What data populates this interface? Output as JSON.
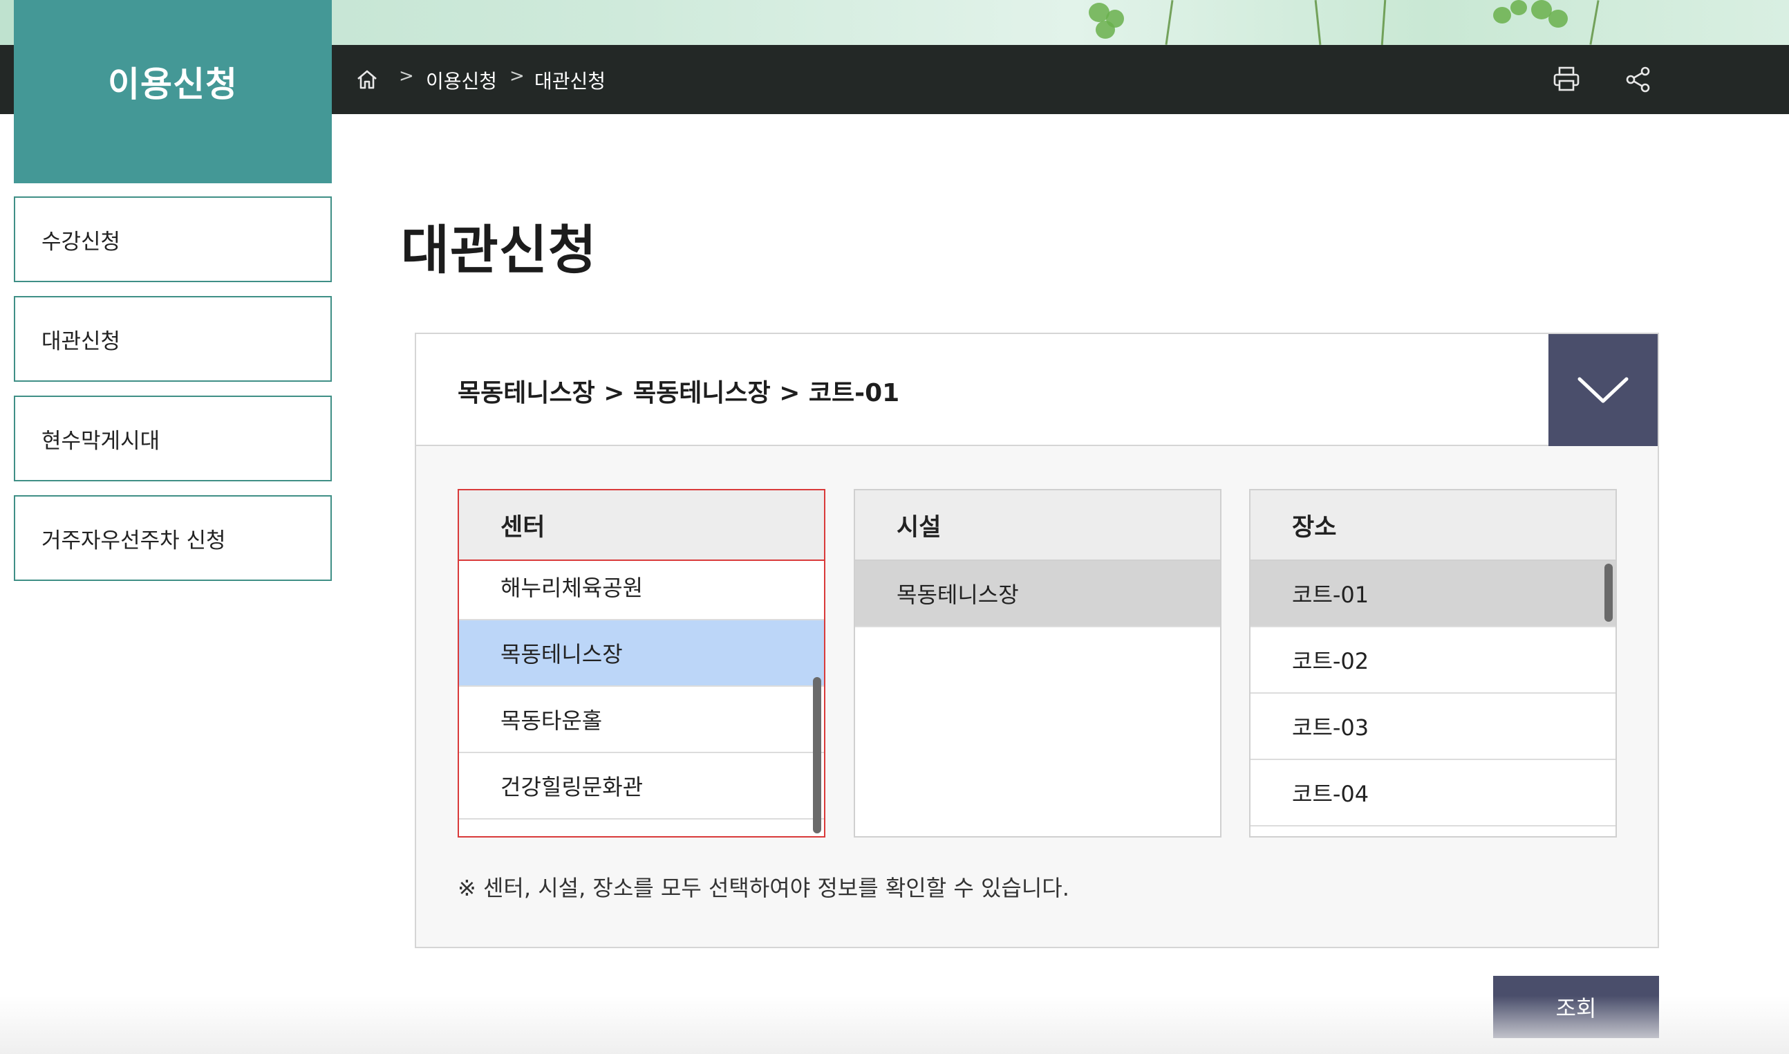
{
  "section": {
    "title": "이용신청"
  },
  "breadcrumb": {
    "separator": ">",
    "items": [
      "이용신청",
      "대관신청"
    ]
  },
  "sidebar": {
    "items": [
      {
        "label": "수강신청"
      },
      {
        "label": "대관신청"
      },
      {
        "label": "현수막게시대"
      },
      {
        "label": "거주자우선주차 신청"
      }
    ]
  },
  "page": {
    "title": "대관신청"
  },
  "selector": {
    "path": "목동테니스장 > 목동테니스장 > 코트-01",
    "center": {
      "header": "센터",
      "items": [
        "해누리체육공원",
        "목동테니스장",
        "목동타운홀",
        "건강힐링문화관"
      ],
      "selected": "목동테니스장"
    },
    "facility": {
      "header": "시설",
      "items": [
        "목동테니스장"
      ],
      "selected": "목동테니스장"
    },
    "place": {
      "header": "장소",
      "items": [
        "코트-01",
        "코트-02",
        "코트-03",
        "코트-04"
      ],
      "selected": "코트-01"
    },
    "notice": "※ 센터, 시설, 장소를 모두 선택하여야 정보를 확인할 수 있습니다."
  },
  "actions": {
    "search_label": "조회"
  },
  "icons": {
    "home": "home-icon",
    "print": "print-icon",
    "share": "share-icon",
    "toggle": "chevron-down-icon"
  },
  "colors": {
    "accent": "#449896",
    "dark_bar": "#232826",
    "button": "#4a4e6b",
    "selected_blue": "#bcd6f8",
    "active_border": "#d93a3a"
  }
}
